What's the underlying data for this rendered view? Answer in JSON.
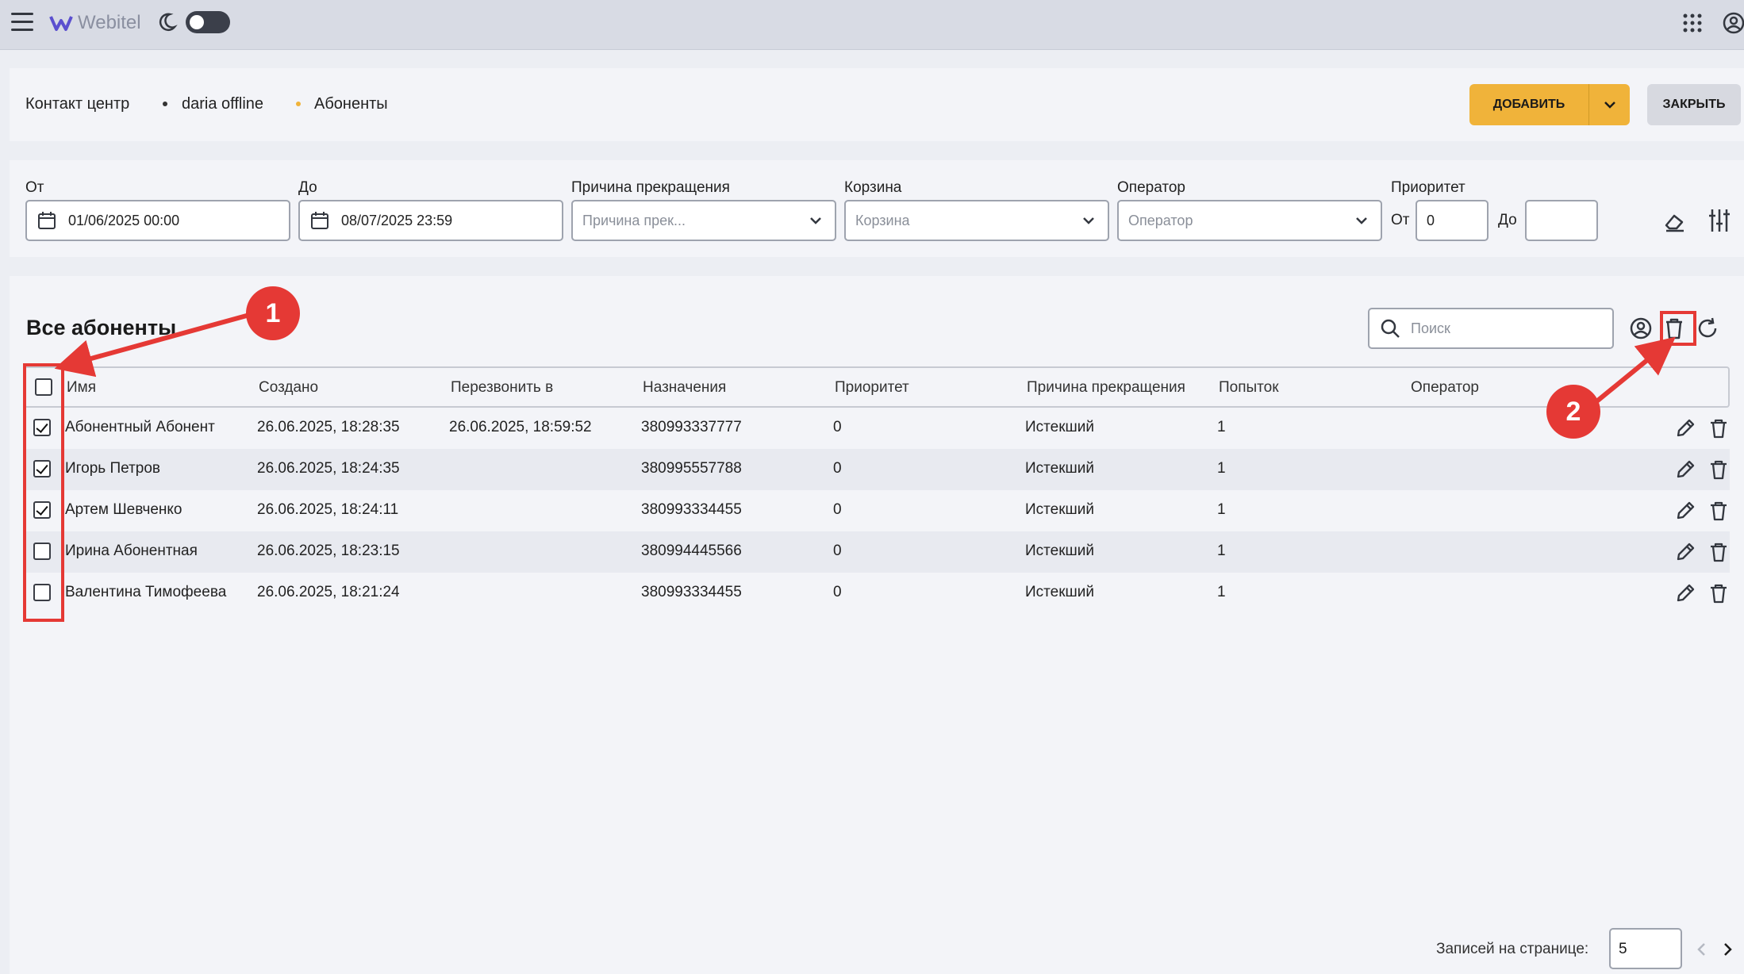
{
  "app": {
    "logo_text": "Webitel"
  },
  "colors": {
    "accent": "#f0b33a",
    "annotation": "#e53935"
  },
  "breadcrumb": {
    "items": [
      "Контакт центр",
      "daria offline",
      "Абоненты"
    ]
  },
  "header_buttons": {
    "add": "ДОБАВИТЬ",
    "close": "ЗАКРЫТЬ"
  },
  "filters": {
    "from_label": "От",
    "from_value": "01/06/2025 00:00",
    "to_label": "До",
    "to_value": "08/07/2025 23:59",
    "reason_label": "Причина прекращения",
    "reason_placeholder": "Причина прек...",
    "bucket_label": "Корзина",
    "bucket_placeholder": "Корзина",
    "operator_label": "Оператор",
    "operator_placeholder": "Оператор",
    "priority_label": "Приоритет",
    "priority_from_label": "От",
    "priority_from_value": "0",
    "priority_to_label": "До",
    "priority_to_value": ""
  },
  "table": {
    "title": "Все абоненты",
    "search_placeholder": "Поиск",
    "columns": [
      "Имя",
      "Создано",
      "Перезвонить в",
      "Назначения",
      "Приоритет",
      "Причина прекращения",
      "Попыток",
      "Оператор"
    ],
    "rows": [
      {
        "checked": true,
        "name": "Абонентный Абонент",
        "created": "26.06.2025, 18:28:35",
        "callback": "26.06.2025, 18:59:52",
        "destination": "380993337777",
        "priority": "0",
        "reason": "Истекший",
        "attempts": "1",
        "operator": ""
      },
      {
        "checked": true,
        "name": "Игорь Петров",
        "created": "26.06.2025, 18:24:35",
        "callback": "",
        "destination": "380995557788",
        "priority": "0",
        "reason": "Истекший",
        "attempts": "1",
        "operator": ""
      },
      {
        "checked": true,
        "name": "Артем Шевченко",
        "created": "26.06.2025, 18:24:11",
        "callback": "",
        "destination": "380993334455",
        "priority": "0",
        "reason": "Истекший",
        "attempts": "1",
        "operator": ""
      },
      {
        "checked": false,
        "name": "Ирина Абонентная",
        "created": "26.06.2025, 18:23:15",
        "callback": "",
        "destination": "380994445566",
        "priority": "0",
        "reason": "Истекший",
        "attempts": "1",
        "operator": ""
      },
      {
        "checked": false,
        "name": "Валентина Тимофеева",
        "created": "26.06.2025, 18:21:24",
        "callback": "",
        "destination": "380993334455",
        "priority": "0",
        "reason": "Истекший",
        "attempts": "1",
        "operator": ""
      }
    ]
  },
  "pagination": {
    "label": "Записей на странице:",
    "value": "5"
  },
  "annotations": {
    "badge1": "1",
    "badge2": "2"
  },
  "icons": [
    "menu-icon",
    "logo-icon",
    "moon-icon",
    "apps-icon",
    "account-icon",
    "calendar-icon",
    "chevron-down-icon",
    "eraser-icon",
    "sliders-icon",
    "search-icon",
    "user-circle-icon",
    "trash-icon",
    "refresh-icon",
    "pencil-icon",
    "chevron-left-icon",
    "chevron-right-icon"
  ]
}
